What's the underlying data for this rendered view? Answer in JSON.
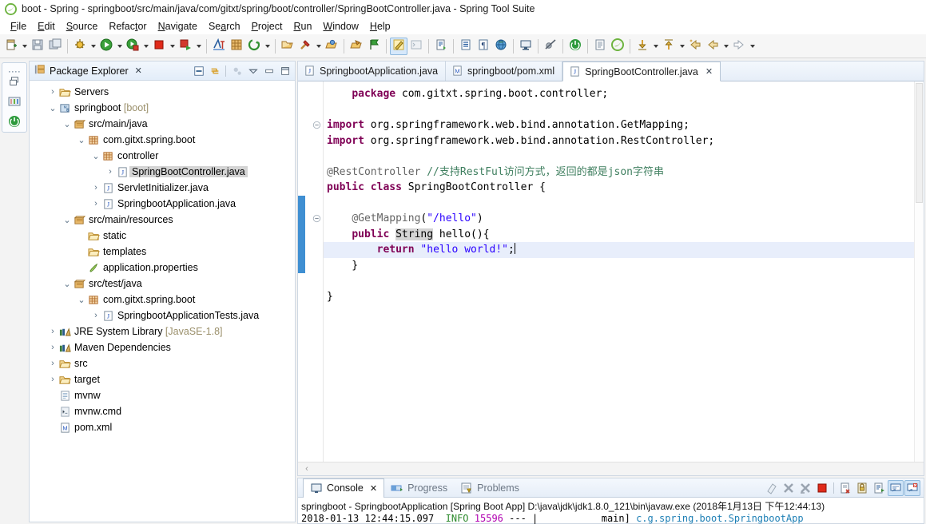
{
  "window": {
    "title": "boot - Spring - springboot/src/main/java/com/gitxt/spring/boot/controller/SpringBootController.java - Spring Tool Suite",
    "logo_icon": "spring-leaf-icon"
  },
  "menubar": {
    "items": [
      {
        "label": "File",
        "mnemonic": "F"
      },
      {
        "label": "Edit",
        "mnemonic": "E"
      },
      {
        "label": "Source",
        "mnemonic": "S"
      },
      {
        "label": "Refactor",
        "mnemonic": "t"
      },
      {
        "label": "Navigate",
        "mnemonic": "N"
      },
      {
        "label": "Search",
        "mnemonic": "a"
      },
      {
        "label": "Project",
        "mnemonic": "P"
      },
      {
        "label": "Run",
        "mnemonic": "R"
      },
      {
        "label": "Window",
        "mnemonic": "W"
      },
      {
        "label": "Help",
        "mnemonic": "H"
      }
    ]
  },
  "toolbar": {
    "buttons": [
      {
        "name": "new-wizard-button",
        "icon": "new-file-icon",
        "dropdown": true
      },
      {
        "name": "save-button",
        "icon": "save-icon",
        "dropdown": false
      },
      {
        "name": "save-all-button",
        "icon": "save-all-icon",
        "dropdown": false
      },
      {
        "name": "debug-button",
        "icon": "debug-bug-icon",
        "dropdown": true
      },
      {
        "name": "run-button",
        "icon": "run-green-play-icon",
        "dropdown": true
      },
      {
        "name": "boot-dashboard-run-button",
        "icon": "run-spring-icon",
        "dropdown": true
      },
      {
        "name": "stop-button",
        "icon": "stop-red-square-icon",
        "dropdown": true
      },
      {
        "name": "relaunch-button",
        "icon": "relaunch-icon",
        "dropdown": true
      },
      {
        "name": "open-type-button",
        "icon": "open-type-icon",
        "dropdown": false
      },
      {
        "name": "new-java-package-button",
        "icon": "new-package-icon",
        "dropdown": false
      },
      {
        "name": "refresh-button",
        "icon": "refresh-circular-icon",
        "dropdown": true
      },
      {
        "name": "open-resource-button",
        "icon": "open-folder-icon",
        "dropdown": false
      },
      {
        "name": "build-button",
        "icon": "hammer-icon",
        "dropdown": true
      },
      {
        "name": "search-resource-button",
        "icon": "open-folder-arrow-icon",
        "dropdown": false
      },
      {
        "name": "last-edit-button",
        "icon": "last-edit-location-icon",
        "dropdown": false
      },
      {
        "name": "spring-explorer-button",
        "icon": "spring-flag-icon",
        "dropdown": false
      },
      {
        "name": "java-perspective-button",
        "icon": "java-pencil-icon",
        "dropdown": false,
        "active": true
      },
      {
        "name": "terminal-button",
        "icon": "terminal-icon",
        "dropdown": false
      },
      {
        "name": "new-bean-button",
        "icon": "bean-config-icon",
        "dropdown": false
      },
      {
        "name": "toggle-markers-button",
        "icon": "markers-icon",
        "dropdown": false
      },
      {
        "name": "paragraph-button",
        "icon": "pilcrow-icon",
        "dropdown": false
      },
      {
        "name": "open-web-browser-button",
        "icon": "globe-icon",
        "dropdown": false
      },
      {
        "name": "open-console-button",
        "icon": "console-monitor-icon",
        "dropdown": false
      },
      {
        "name": "toggle-breakpoints-button",
        "icon": "skip-breakpoints-icon",
        "dropdown": false
      },
      {
        "name": "boot-dashboard-button",
        "icon": "spring-boot-green-icon",
        "dropdown": false
      },
      {
        "name": "new-xml-button",
        "icon": "xml-file-icon",
        "dropdown": false
      },
      {
        "name": "spring-boot-icon-button",
        "icon": "spring-leaf-icon",
        "dropdown": false
      },
      {
        "name": "next-annotation-button",
        "icon": "down-arrow-yellow-icon",
        "dropdown": true
      },
      {
        "name": "previous-annotation-button",
        "icon": "up-arrow-yellow-icon",
        "dropdown": true
      },
      {
        "name": "back-history-button",
        "icon": "back-arrow-icon",
        "dropdown": false
      },
      {
        "name": "forward-nav-button",
        "icon": "left-arrow-yellow-icon",
        "dropdown": true
      },
      {
        "name": "forward-history-button",
        "icon": "right-arrow-white-icon",
        "dropdown": true
      }
    ]
  },
  "fastview": {
    "buttons": [
      {
        "name": "restore-view-button",
        "icon": "restore-window-icon"
      },
      {
        "name": "boot-dashboard-view-button",
        "icon": "boot-dashboard-icon"
      },
      {
        "name": "spring-boot-view-button",
        "icon": "spring-boot-green-icon"
      }
    ]
  },
  "explorer": {
    "title": "Package Explorer",
    "close_label": "✕",
    "tools": [
      {
        "name": "collapse-all-button",
        "icon": "collapse-all-icon"
      },
      {
        "name": "link-with-editor-button",
        "icon": "link-editor-icon"
      },
      {
        "name": "focus-on-active-task-button",
        "icon": "focus-task-icon"
      },
      {
        "name": "view-menu-button",
        "icon": "chevron-down-icon"
      },
      {
        "name": "minimize-view-button",
        "icon": "minimize-icon"
      },
      {
        "name": "maximize-view-button",
        "icon": "maximize-icon"
      }
    ],
    "tree": [
      {
        "label": "Servers",
        "indent": 1,
        "twisty": "collapsed",
        "icon": "folder-icon",
        "selected": false
      },
      {
        "label": "springboot",
        "suffix": " [boot]",
        "indent": 1,
        "twisty": "expanded",
        "icon": "maven-project-icon",
        "selected": false
      },
      {
        "label": "src/main/java",
        "indent": 2,
        "twisty": "expanded",
        "icon": "source-folder-icon",
        "selected": false
      },
      {
        "label": "com.gitxt.spring.boot",
        "indent": 3,
        "twisty": "expanded",
        "icon": "package-icon",
        "selected": false
      },
      {
        "label": "controller",
        "indent": 4,
        "twisty": "expanded",
        "icon": "package-icon",
        "selected": false
      },
      {
        "label": "SpringBootController.java",
        "indent": 5,
        "twisty": "collapsed",
        "icon": "java-file-icon",
        "selected": true
      },
      {
        "label": "ServletInitializer.java",
        "indent": 4,
        "twisty": "collapsed",
        "icon": "java-file-icon",
        "selected": false
      },
      {
        "label": "SpringbootApplication.java",
        "indent": 4,
        "twisty": "collapsed",
        "icon": "java-file-icon",
        "selected": false
      },
      {
        "label": "src/main/resources",
        "indent": 2,
        "twisty": "expanded",
        "icon": "source-folder-icon",
        "selected": false
      },
      {
        "label": "static",
        "indent": 3,
        "twisty": "none",
        "icon": "folder-icon",
        "selected": false
      },
      {
        "label": "templates",
        "indent": 3,
        "twisty": "none",
        "icon": "folder-icon",
        "selected": false
      },
      {
        "label": "application.properties",
        "indent": 3,
        "twisty": "none",
        "icon": "properties-file-icon",
        "selected": false
      },
      {
        "label": "src/test/java",
        "indent": 2,
        "twisty": "expanded",
        "icon": "source-folder-icon",
        "selected": false
      },
      {
        "label": "com.gitxt.spring.boot",
        "indent": 3,
        "twisty": "expanded",
        "icon": "package-icon",
        "selected": false
      },
      {
        "label": "SpringbootApplicationTests.java",
        "indent": 4,
        "twisty": "collapsed",
        "icon": "java-file-icon",
        "selected": false
      },
      {
        "label": "JRE System Library",
        "suffix": " [JavaSE-1.8]",
        "indent": 1,
        "twisty": "collapsed",
        "icon": "library-icon",
        "selected": false
      },
      {
        "label": "Maven Dependencies",
        "indent": 1,
        "twisty": "collapsed",
        "icon": "library-icon",
        "selected": false
      },
      {
        "label": "src",
        "indent": 1,
        "twisty": "collapsed",
        "icon": "folder-icon",
        "selected": false
      },
      {
        "label": "target",
        "indent": 1,
        "twisty": "collapsed",
        "icon": "folder-icon",
        "selected": false
      },
      {
        "label": "mvnw",
        "indent": 1,
        "twisty": "none",
        "icon": "text-file-icon",
        "selected": false
      },
      {
        "label": "mvnw.cmd",
        "indent": 1,
        "twisty": "none",
        "icon": "cmd-file-icon",
        "selected": false
      },
      {
        "label": "pom.xml",
        "indent": 1,
        "twisty": "none",
        "icon": "maven-xml-icon",
        "selected": false
      }
    ]
  },
  "editor": {
    "tabs": [
      {
        "label": "SpringbootApplication.java",
        "icon": "java-file-icon",
        "selected": false,
        "closable": false
      },
      {
        "label": "springboot/pom.xml",
        "icon": "maven-xml-icon",
        "selected": false,
        "closable": false
      },
      {
        "label": "SpringBootController.java",
        "icon": "java-file-icon",
        "selected": true,
        "closable": true
      }
    ],
    "close_label": "✕",
    "code_lines": [
      {
        "tokens": [
          {
            "t": "    ",
            "c": "plain"
          },
          {
            "t": "package",
            "c": "kw"
          },
          {
            "t": " com.gitxt.spring.boot.controller;",
            "c": "plain"
          }
        ],
        "highlight": false,
        "fold": false,
        "change": false
      },
      {
        "tokens": [],
        "highlight": false,
        "fold": false,
        "change": false
      },
      {
        "tokens": [
          {
            "t": "",
            "c": "plain"
          },
          {
            "t": "import",
            "c": "kw"
          },
          {
            "t": " org.springframework.web.bind.annotation.GetMapping;",
            "c": "plain"
          }
        ],
        "highlight": false,
        "fold": true,
        "change": false
      },
      {
        "tokens": [
          {
            "t": "",
            "c": "plain"
          },
          {
            "t": "import",
            "c": "kw"
          },
          {
            "t": " org.springframework.web.bind.annotation.RestController;",
            "c": "plain"
          }
        ],
        "highlight": false,
        "fold": false,
        "change": false
      },
      {
        "tokens": [],
        "highlight": false,
        "fold": false,
        "change": false
      },
      {
        "tokens": [
          {
            "t": "@RestController",
            "c": "ann"
          },
          {
            "t": " ",
            "c": "plain"
          },
          {
            "t": "//支持RestFul访问方式，返回的都是json字符串",
            "c": "cmt"
          }
        ],
        "highlight": false,
        "fold": false,
        "change": false
      },
      {
        "tokens": [
          {
            "t": "public class",
            "c": "kw"
          },
          {
            "t": " SpringBootController {",
            "c": "plain"
          }
        ],
        "highlight": false,
        "fold": false,
        "change": false
      },
      {
        "tokens": [],
        "highlight": false,
        "fold": false,
        "change": true
      },
      {
        "tokens": [
          {
            "t": "    ",
            "c": "plain"
          },
          {
            "t": "@GetMapping",
            "c": "ann"
          },
          {
            "t": "(",
            "c": "plain"
          },
          {
            "t": "\"/hello\"",
            "c": "str"
          },
          {
            "t": ")",
            "c": "plain"
          }
        ],
        "highlight": false,
        "fold": true,
        "change": true
      },
      {
        "tokens": [
          {
            "t": "    ",
            "c": "plain"
          },
          {
            "t": "public",
            "c": "kw"
          },
          {
            "t": " ",
            "c": "plain"
          },
          {
            "t": "String",
            "c": "occ"
          },
          {
            "t": " hello(){",
            "c": "plain"
          }
        ],
        "highlight": false,
        "fold": false,
        "change": true
      },
      {
        "tokens": [
          {
            "t": "        ",
            "c": "plain"
          },
          {
            "t": "return",
            "c": "kw"
          },
          {
            "t": " ",
            "c": "plain"
          },
          {
            "t": "\"hello world!\"",
            "c": "str"
          },
          {
            "t": ";",
            "c": "plain"
          }
        ],
        "highlight": true,
        "fold": false,
        "change": true,
        "cursor": true
      },
      {
        "tokens": [
          {
            "t": "    }",
            "c": "plain"
          }
        ],
        "highlight": false,
        "fold": false,
        "change": true
      },
      {
        "tokens": [],
        "highlight": false,
        "fold": false,
        "change": false
      },
      {
        "tokens": [
          {
            "t": "}",
            "c": "plain"
          }
        ],
        "highlight": false,
        "fold": false,
        "change": false
      }
    ],
    "hscroll_left_icon": "chevron-left-icon"
  },
  "console": {
    "tabs": [
      {
        "label": "Console",
        "icon": "console-icon",
        "selected": true,
        "closable": true
      },
      {
        "label": "Progress",
        "icon": "progress-icon",
        "selected": false,
        "closable": false
      },
      {
        "label": "Problems",
        "icon": "problems-icon",
        "selected": false,
        "closable": false
      }
    ],
    "close_label": "✕",
    "tools": [
      {
        "name": "clear-console-button",
        "icon": "eraser-icon",
        "on": false
      },
      {
        "name": "terminate-all-button",
        "icon": "remove-launch-icon",
        "on": false
      },
      {
        "name": "remove-all-terminated-button",
        "icon": "remove-all-icon",
        "on": false
      },
      {
        "name": "stop-button",
        "icon": "stop-red-square-icon",
        "on": false
      },
      {
        "name": "clear-button",
        "icon": "clear-console-icon",
        "on": false
      },
      {
        "name": "scroll-lock-button",
        "icon": "lock-scroll-icon",
        "on": false
      },
      {
        "name": "pin-console-button",
        "icon": "pin-console-icon",
        "on": false
      },
      {
        "name": "display-selected-console-button",
        "icon": "display-console-icon",
        "on": true
      },
      {
        "name": "open-console-button",
        "icon": "open-console-icon",
        "on": true
      }
    ],
    "launch_line": "springboot - SpringbootApplication [Spring Boot App] D:\\java\\jdk\\jdk1.8.0_121\\bin\\javaw.exe (2018年1月13日 下午12:44:13)",
    "log_segments": [
      {
        "t": "2018-01-13 12:44:15.097",
        "c": "plain"
      },
      {
        "t": "  ",
        "c": "plain"
      },
      {
        "t": "INFO",
        "c": "c-green"
      },
      {
        "t": " ",
        "c": "plain"
      },
      {
        "t": "15596",
        "c": "c-mag"
      },
      {
        "t": " --- |",
        "c": "plain"
      },
      {
        "t": "           main] ",
        "c": "plain"
      },
      {
        "t": "c.g.spring.boot.SpringbootApp",
        "c": "c-cyan"
      }
    ]
  }
}
